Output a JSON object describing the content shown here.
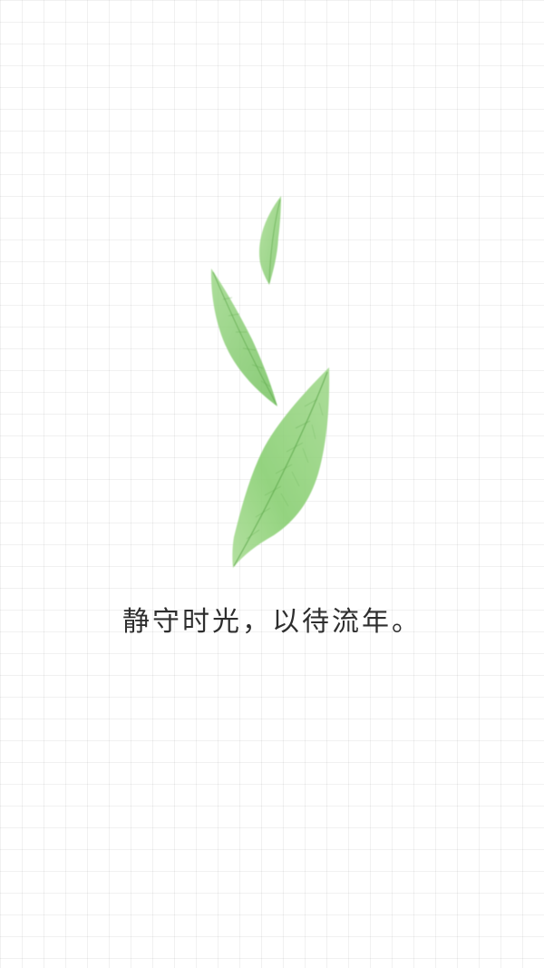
{
  "background": {
    "paper_color": "#fdfdfd",
    "grid_color": "#d9d9d9"
  },
  "illustration": {
    "leaves": [
      {
        "name": "small-leaf-icon",
        "color": "#8fd27a"
      },
      {
        "name": "middle-leaf-icon",
        "color": "#86cf6f"
      },
      {
        "name": "large-leaf-icon",
        "color": "#7fcb68"
      }
    ],
    "vein_color": "#5fa94c"
  },
  "caption": {
    "text": "静守时光，以待流年。"
  }
}
